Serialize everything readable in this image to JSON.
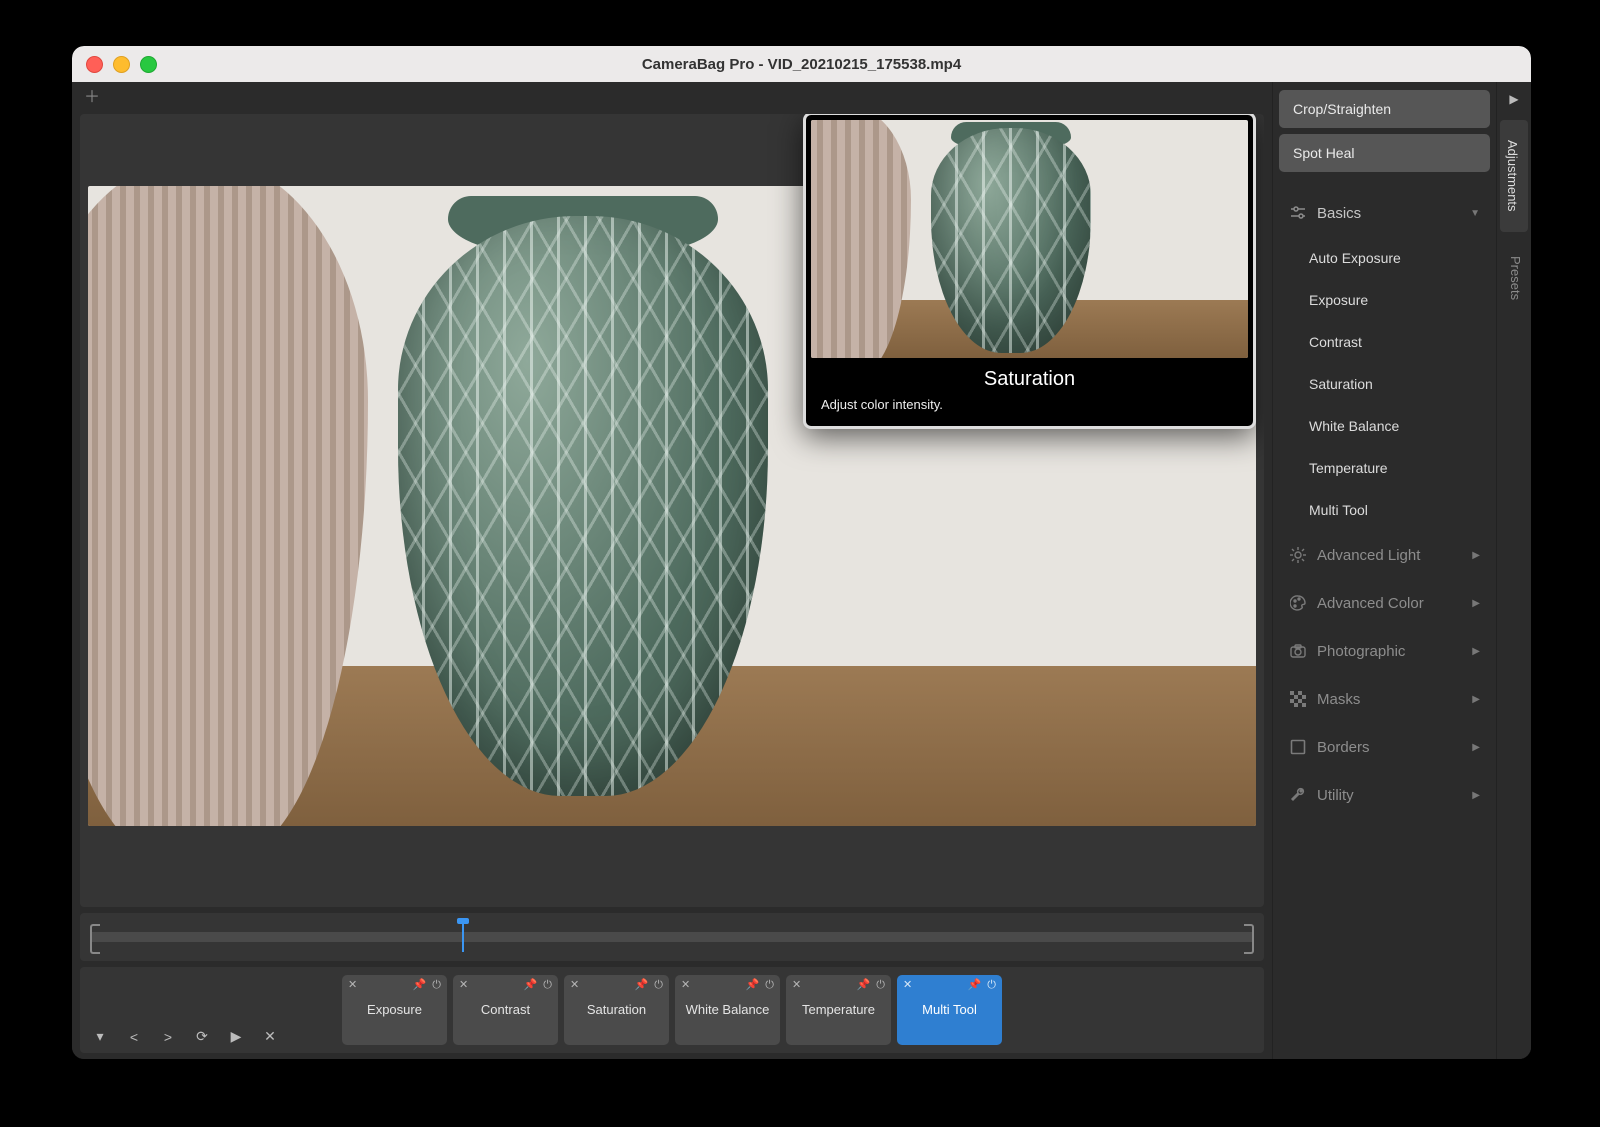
{
  "window": {
    "title": "CameraBag Pro - VID_20210215_175538.mp4"
  },
  "tooltip": {
    "title": "Saturation",
    "description": "Adjust color intensity."
  },
  "panel": {
    "crop": "Crop/Straighten",
    "spot": "Spot Heal",
    "sections": {
      "basics": {
        "label": "Basics",
        "expanded": true,
        "items": [
          "Auto Exposure",
          "Exposure",
          "Contrast",
          "Saturation",
          "White Balance",
          "Temperature",
          "Multi Tool"
        ]
      },
      "adv_light": {
        "label": "Advanced Light"
      },
      "adv_color": {
        "label": "Advanced Color"
      },
      "photographic": {
        "label": "Photographic"
      },
      "masks": {
        "label": "Masks"
      },
      "borders": {
        "label": "Borders"
      },
      "utility": {
        "label": "Utility"
      }
    }
  },
  "chips": [
    {
      "label": "Exposure",
      "selected": false
    },
    {
      "label": "Contrast",
      "selected": false
    },
    {
      "label": "Saturation",
      "selected": false
    },
    {
      "label": "White Balance",
      "selected": false
    },
    {
      "label": "Temperature",
      "selected": false
    },
    {
      "label": "Multi Tool",
      "selected": true
    }
  ],
  "vtabs": {
    "adjustments": "Adjustments",
    "presets": "Presets"
  }
}
